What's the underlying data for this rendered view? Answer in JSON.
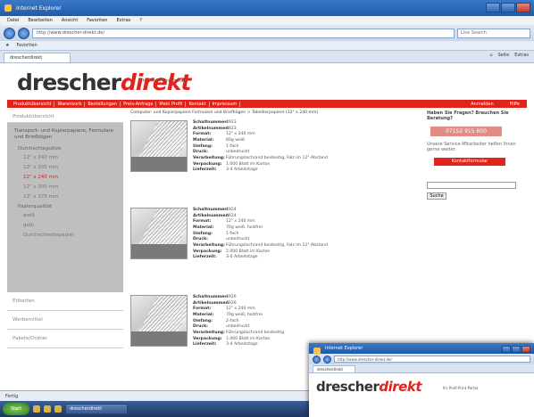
{
  "window": {
    "title": "Internet Explorer"
  },
  "menu": [
    "Datei",
    "Bearbeiten",
    "Ansicht",
    "Favoriten",
    "Extras",
    "?"
  ],
  "address": {
    "url": "http://www.drescher-direkt.de/"
  },
  "search": {
    "placeholder": "Live Search"
  },
  "favorites": {
    "label": "Favoriten"
  },
  "tab": {
    "label": "drescherdirekt"
  },
  "command_bar": [
    "Seite",
    "Extras"
  ],
  "logo": {
    "part1": "drescher",
    "part2": "direkt",
    "tagline": "Ihr Profi-Print-Portal"
  },
  "nav": {
    "items": [
      "Produktübersicht",
      "Warenkorb",
      "Bestellungen",
      "Preis-Anfrage",
      "Mein Profil",
      "Kontakt",
      "Impressum"
    ],
    "right": [
      "Anmelden",
      "Hilfe"
    ]
  },
  "sidebar": {
    "header": "Produktübersicht",
    "active_title": "Transport- und Kopierpapiere, Formulare und Briefbögen",
    "group1": "Durchschlagsätze",
    "options1": [
      "12\" x 240 mm",
      "12\" x 305 mm",
      "12\" x 240 mm",
      "12\" x 305 mm",
      "12\" x 375 mm"
    ],
    "selected_index": 2,
    "group2": "Papierqualität",
    "options2": [
      "weiß",
      "gelb",
      "Durchschreibepapier"
    ],
    "links": [
      "Etiketten",
      "Werbemittel",
      "Pakete/Ordner"
    ]
  },
  "content": {
    "intro": "Computer- und Kopierpapiere Formulare und Briefbögen > Tabellierpapiere (12\" x 240 mm)",
    "products": [
      {
        "specs": [
          [
            "Schaltnummer:",
            "4923"
          ],
          [
            "Artikelnummer:",
            "4923"
          ],
          [
            "Format:",
            "12\" x 240 mm"
          ],
          [
            "Material:",
            "60g weiß"
          ],
          [
            "Umfang:",
            "1-fach"
          ],
          [
            "Druck:",
            "unbedruckt"
          ],
          [
            "Verarbeitung:",
            "Führungslochrand beidseitig, Falz im 12\"-Abstand"
          ],
          [
            "Verpackung:",
            "1.000 Blatt im Karton"
          ],
          [
            "Lieferzeit:",
            "3-4 Arbeitstage"
          ]
        ]
      },
      {
        "specs": [
          [
            "Schaltnummer:",
            "4924"
          ],
          [
            "Artikelnummer:",
            "4924"
          ],
          [
            "Format:",
            "12\" x 240 mm"
          ],
          [
            "Material:",
            "70g weiß, holzfrei"
          ],
          [
            "Umfang:",
            "1-fach"
          ],
          [
            "Druck:",
            "unbedruckt"
          ],
          [
            "Verarbeitung:",
            "Führungslochrand beidseitig, Falz im 12\"-Abstand"
          ],
          [
            "Verpackung:",
            "2.000 Blatt im Karton"
          ],
          [
            "Lieferzeit:",
            "3-4 Arbeitstage"
          ]
        ]
      },
      {
        "specs": [
          [
            "Schaltnummer:",
            "4926"
          ],
          [
            "Artikelnummer:",
            "4926"
          ],
          [
            "Format:",
            "12\" x 240 mm"
          ],
          [
            "Material:",
            "70g weiß, holzfrei"
          ],
          [
            "Umfang:",
            "2-fach"
          ],
          [
            "Druck:",
            "unbedruckt"
          ],
          [
            "Verarbeitung:",
            "Führungslochrand beidseitig"
          ],
          [
            "Verpackung:",
            "1.000 Blatt im Karton"
          ],
          [
            "Lieferzeit:",
            "3-4 Arbeitstage"
          ]
        ]
      }
    ]
  },
  "rightcol": {
    "title": "Haben Sie Fragen? Brauchen Sie Beratung?",
    "phone": "07152 915 600",
    "text": "Unsere Service-Mitarbeiter helfen Ihnen gerne weiter.",
    "contact_button": "Kontaktformular",
    "search_button": "Suche"
  },
  "status": {
    "text": "Fertig"
  },
  "taskbar": {
    "start": "Start",
    "task": "drescherdirekt"
  },
  "win2": {
    "title": "Internet Explorer",
    "url": "http://www.drescher-direkt.de/",
    "tab": "drescherdirekt"
  }
}
